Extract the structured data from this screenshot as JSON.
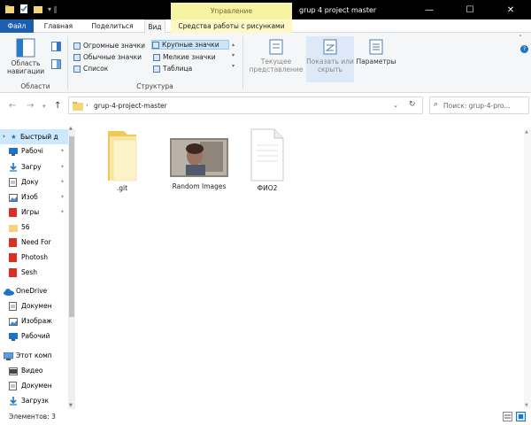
{
  "titlebar": {
    "context_group": "Управление",
    "window_title": "grup 4 project master",
    "minimize": "—",
    "maximize": "☐",
    "close": "✕"
  },
  "ribbon_tabs": [
    "Файл",
    "Главная",
    "Поделиться",
    "Вид",
    "Средства работы с рисунками"
  ],
  "ribbon": {
    "nav_pane_label": "Область навигации",
    "panes_group": "Области",
    "layouts": {
      "col1": [
        "Огромные значки",
        "Обычные значки",
        "Список"
      ],
      "col2": [
        "Крупные значки",
        "Мелкие значки",
        "Таблица"
      ]
    },
    "layout_group": "Структура",
    "current_view": "Текущее представление",
    "show_hide": "Показать или скрыть",
    "options": "Параметры"
  },
  "address": {
    "path": "grup-4-project-master",
    "search_placeholder": "Поиск: grup-4-pro..."
  },
  "nav_pane": {
    "items": [
      {
        "label": "Быстрый д",
        "icon": "star-icon"
      },
      {
        "label": "Рабочі",
        "icon": "desktop-icon"
      },
      {
        "label": "Загру",
        "icon": "download-icon"
      },
      {
        "label": "Доку",
        "icon": "document-icon"
      },
      {
        "label": "Изоб",
        "icon": "image-icon"
      },
      {
        "label": "Игры",
        "icon": "folder-red-icon"
      },
      {
        "label": "56",
        "icon": "folder-yellow-icon"
      },
      {
        "label": "Need For",
        "icon": "folder-red-icon"
      },
      {
        "label": "Photosh",
        "icon": "folder-red-icon"
      },
      {
        "label": "Sesh",
        "icon": "folder-red-icon"
      },
      {
        "label": "OneDrive",
        "icon": "cloud-icon"
      },
      {
        "label": "Докумен",
        "icon": "document-icon"
      },
      {
        "label": "Изображ",
        "icon": "image-icon"
      },
      {
        "label": "Рабочий",
        "icon": "desktop-icon"
      },
      {
        "label": "Этот комп",
        "icon": "computer-icon"
      },
      {
        "label": "Видео",
        "icon": "video-icon"
      },
      {
        "label": "Докумен",
        "icon": "document-icon"
      },
      {
        "label": "Загрузк",
        "icon": "download-icon"
      }
    ]
  },
  "files": [
    {
      "name": ".git",
      "type": "folder"
    },
    {
      "name": "Random Images",
      "type": "image"
    },
    {
      "name": "ФИО2",
      "type": "file"
    }
  ],
  "status": {
    "item_count": "Элементов: 3"
  },
  "colors": {
    "file_tab": "#1c5fb0",
    "context_tab": "#f6f3a3",
    "selection": "#cce8ff",
    "folder": "#f4d47a"
  }
}
